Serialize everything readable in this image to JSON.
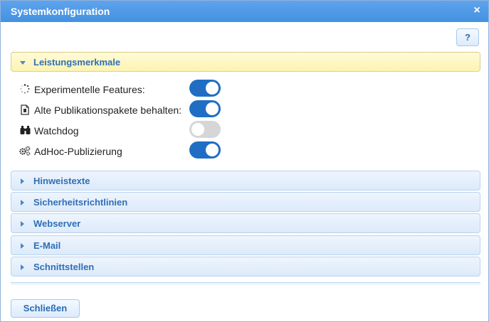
{
  "dialog": {
    "title": "Systemkonfiguration",
    "close_icon": "×",
    "help_label": "?",
    "close_button_label": "Schließen"
  },
  "accordion": {
    "active": {
      "label": "Leistungsmerkmale",
      "features": [
        {
          "label": "Experimentelle Features:",
          "icon": "spinner-icon",
          "enabled": true
        },
        {
          "label": "Alte Publikationspakete behalten:",
          "icon": "document-icon",
          "enabled": true
        },
        {
          "label": "Watchdog",
          "icon": "binoculars-icon",
          "enabled": false
        },
        {
          "label": "AdHoc-Publizierung",
          "icon": "gears-icon",
          "enabled": true
        }
      ]
    },
    "sections": [
      {
        "label": "Hinweistexte"
      },
      {
        "label": "Sicherheitsrichtlinien"
      },
      {
        "label": "Webserver"
      },
      {
        "label": "E-Mail"
      },
      {
        "label": "Schnittstellen"
      }
    ]
  },
  "colors": {
    "titlebar": "#4a96e6",
    "toggle_on": "#1f6ec4",
    "toggle_off": "#d6d6d6",
    "active_header": "#fdf3b2",
    "header_text": "#2f6fb6"
  }
}
